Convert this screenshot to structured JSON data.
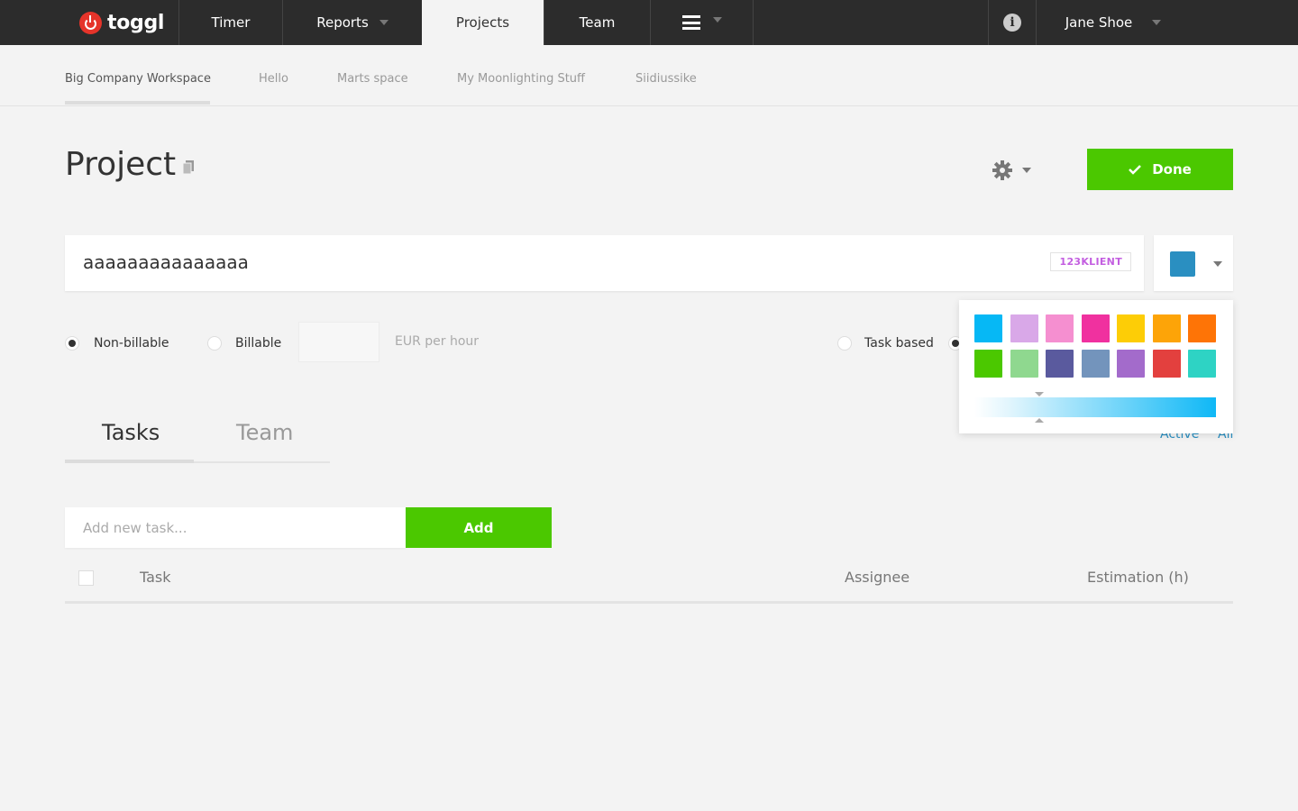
{
  "app": {
    "logo_text": "toggl",
    "brand_red": "#e5342a",
    "accent_green": "#4bc800"
  },
  "nav": {
    "timer": "Timer",
    "reports": "Reports",
    "projects": "Projects",
    "team": "Team",
    "user": "Jane Shoe"
  },
  "workspaces": [
    "Big Company Workspace",
    "Hello",
    "Marts space",
    "My Moonlighting Stuff",
    "Siidiussike"
  ],
  "page": {
    "title": "Project",
    "done_label": "Done"
  },
  "project": {
    "name": "aaaaaaaaaaaaaaa",
    "client": "123KLIENT",
    "color": "#2a8fc1"
  },
  "billing": {
    "non_billable": "Non-billable",
    "billable": "Billable",
    "rate_value": "",
    "rate_suffix": "EUR per hour",
    "task_based": "Task based"
  },
  "tabs": {
    "tasks": "Tasks",
    "team": "Team"
  },
  "filters": {
    "active": "Active",
    "all": "All"
  },
  "add_task": {
    "placeholder": "Add new task...",
    "button": "Add"
  },
  "table": {
    "col_task": "Task",
    "col_assignee": "Assignee",
    "col_estimation": "Estimation (h)"
  },
  "palette": {
    "row1": [
      "#06b8f5",
      "#d9a8e8",
      "#f58fd0",
      "#f0319f",
      "#fdcd06",
      "#fda408",
      "#fe7406"
    ],
    "row2": [
      "#4bc800",
      "#8fd88f",
      "#5a5a9e",
      "#7394bc",
      "#a36bcb",
      "#e3403e",
      "#2ed3c4"
    ]
  }
}
